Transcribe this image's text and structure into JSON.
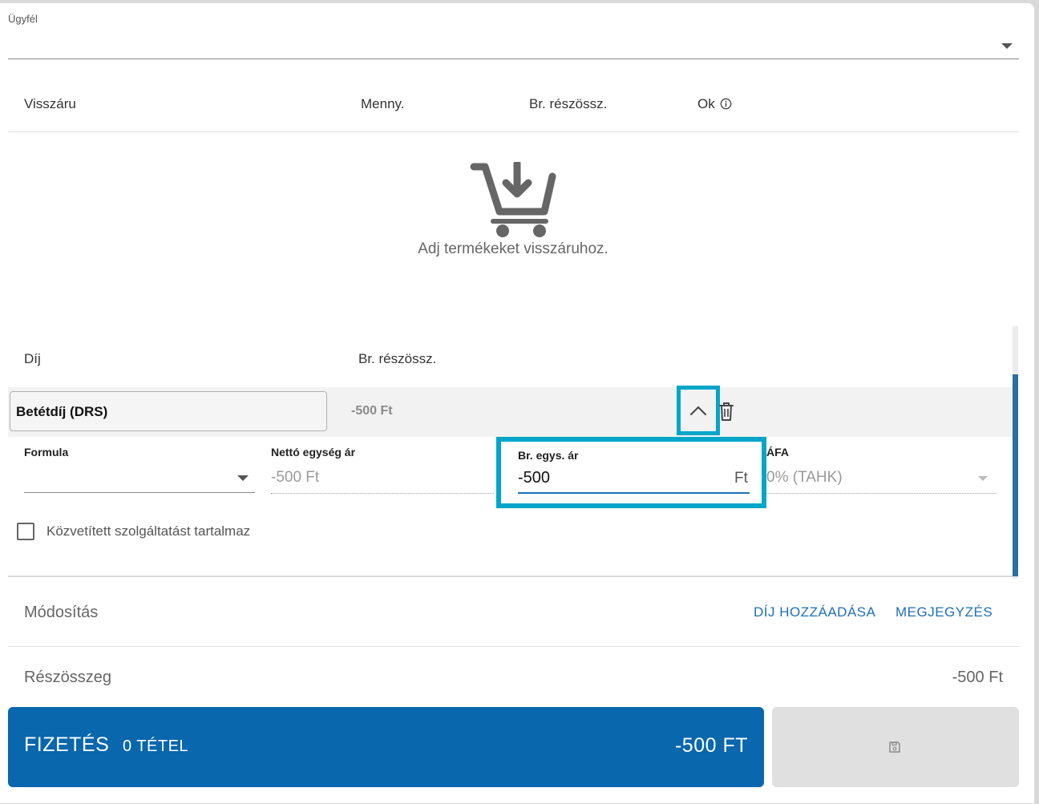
{
  "customer": {
    "label": "Ügyfél"
  },
  "returns_header": {
    "col_item": "Visszáru",
    "col_qty": "Menny.",
    "col_subtotal": "Br. részössz.",
    "col_reason": "Ok"
  },
  "empty_state": {
    "icon": "cart-download-icon",
    "text": "Adj termékeket visszáruhoz."
  },
  "fees_header": {
    "col_fee": "Díj",
    "col_subtotal": "Br. részössz."
  },
  "fee_row": {
    "name": "Betétdíj (DRS)",
    "total": "-500 Ft",
    "formula_label": "Formula",
    "net_label": "Nettó egység ár",
    "net_value": "-500 Ft",
    "gross_label": "Br. egys. ár",
    "gross_value": "-500",
    "gross_unit": "Ft",
    "vat_label": "ÁFA",
    "vat_value": "0% (TAHK)",
    "mediated_label": "Közvetített szolgáltatást tartalmaz"
  },
  "modification": {
    "label": "Módosítás",
    "add_fee": "DÍJ HOZZÁADÁSA",
    "note": "MEGJEGYZÉS"
  },
  "subtotal": {
    "label": "Részösszeg",
    "value": "-500 Ft"
  },
  "pay_button": {
    "label": "FIZETÉS",
    "count": "0 TÉTEL",
    "amount": "-500 FT"
  },
  "colors": {
    "accent": "#0867ad",
    "highlight": "#00a6c9",
    "link": "#1f6fb5"
  }
}
